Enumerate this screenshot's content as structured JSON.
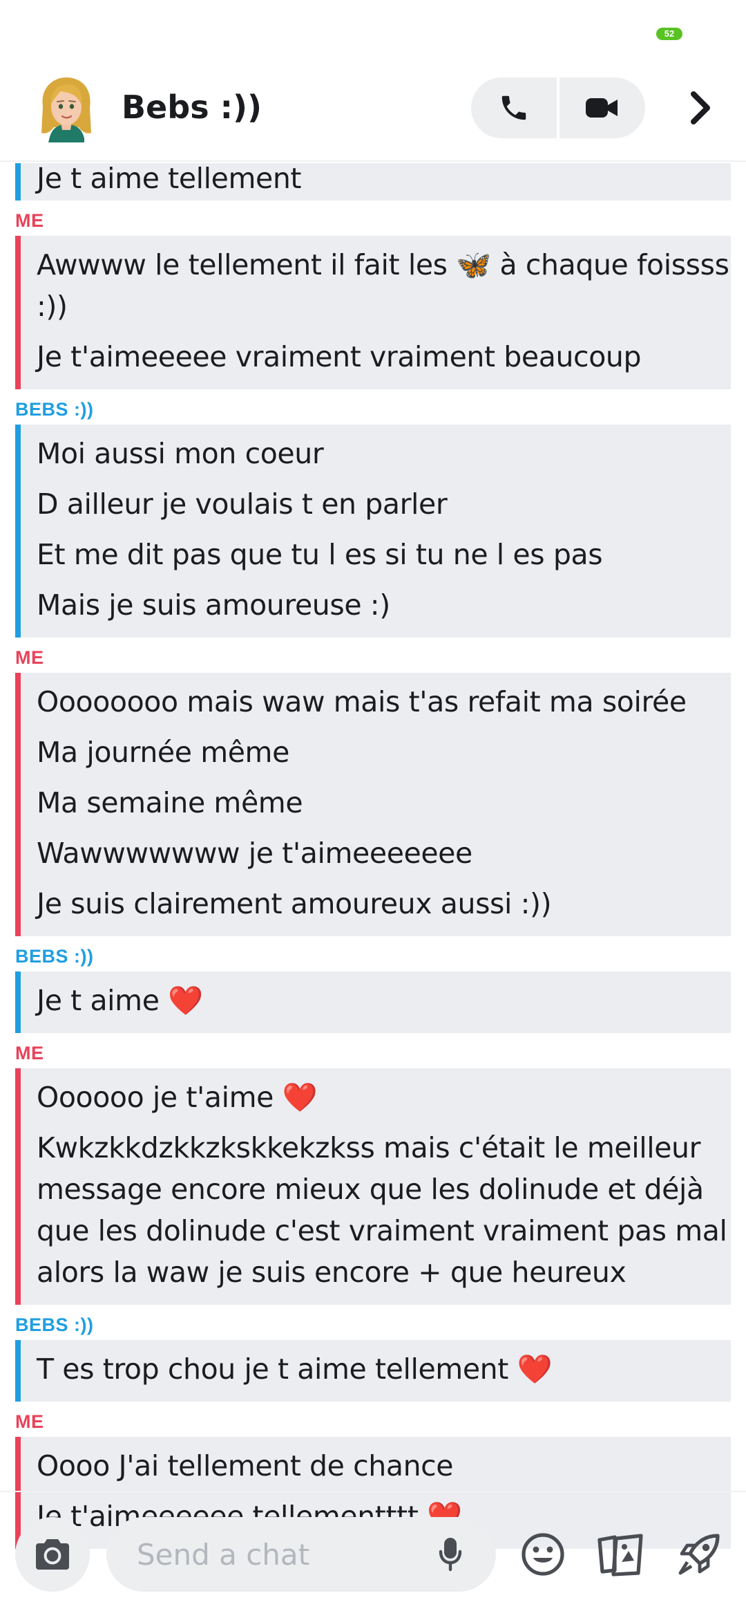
{
  "status_bar": {
    "battery": "52"
  },
  "header": {
    "contact_name": "Bebs :))"
  },
  "chat": [
    {
      "sender": "",
      "side": "them",
      "messages": [
        "Je t aime tellement"
      ]
    },
    {
      "sender": "ME",
      "side": "me",
      "messages": [
        "Awwww le tellement il fait les 🦋 à chaque foissss :))",
        "Je t'aimeeeee vraiment vraiment beaucoup"
      ]
    },
    {
      "sender": "BEBS :))",
      "side": "them",
      "messages": [
        "Moi aussi mon coeur",
        "D ailleur je voulais t en parler",
        "Et me dit pas que tu l es si tu ne l es pas",
        "Mais je suis amoureuse :)"
      ]
    },
    {
      "sender": "ME",
      "side": "me",
      "messages": [
        "Oooooooo mais waw mais t'as refait ma soirée",
        "Ma journée même",
        "Ma semaine même",
        "Wawwwwwww je t'aimeeeeeee",
        "Je suis clairement amoureux aussi :))"
      ]
    },
    {
      "sender": "BEBS :))",
      "side": "them",
      "messages": [
        "Je t aime ❤️"
      ]
    },
    {
      "sender": "ME",
      "side": "me",
      "messages": [
        "Oooooo je t'aime ❤️",
        "Kwkzkkdzkkzkskkekzkss mais c'était le meilleur message encore mieux que les dolinude et déjà que les dolinude c'est vraiment vraiment pas mal alors la waw je suis encore + que heureux"
      ]
    },
    {
      "sender": "BEBS :))",
      "side": "them",
      "messages": [
        "T es trop chou je t aime tellement ❤️"
      ]
    },
    {
      "sender": "ME",
      "side": "me",
      "messages": [
        "Oooo J'ai tellement de chance",
        "Je t'aimeeeeee tellementttt ❤️"
      ]
    }
  ],
  "composer": {
    "placeholder": "Send a chat"
  },
  "colors": {
    "me": "#e9425a",
    "them": "#1f9ee2",
    "bubble_bg": "#ebedf0"
  },
  "icons": [
    "avatar",
    "phone-icon",
    "video-camera-icon",
    "chevron-right-icon",
    "camera-icon",
    "microphone-icon",
    "smiley-icon",
    "cards-icon",
    "rocket-icon"
  ]
}
